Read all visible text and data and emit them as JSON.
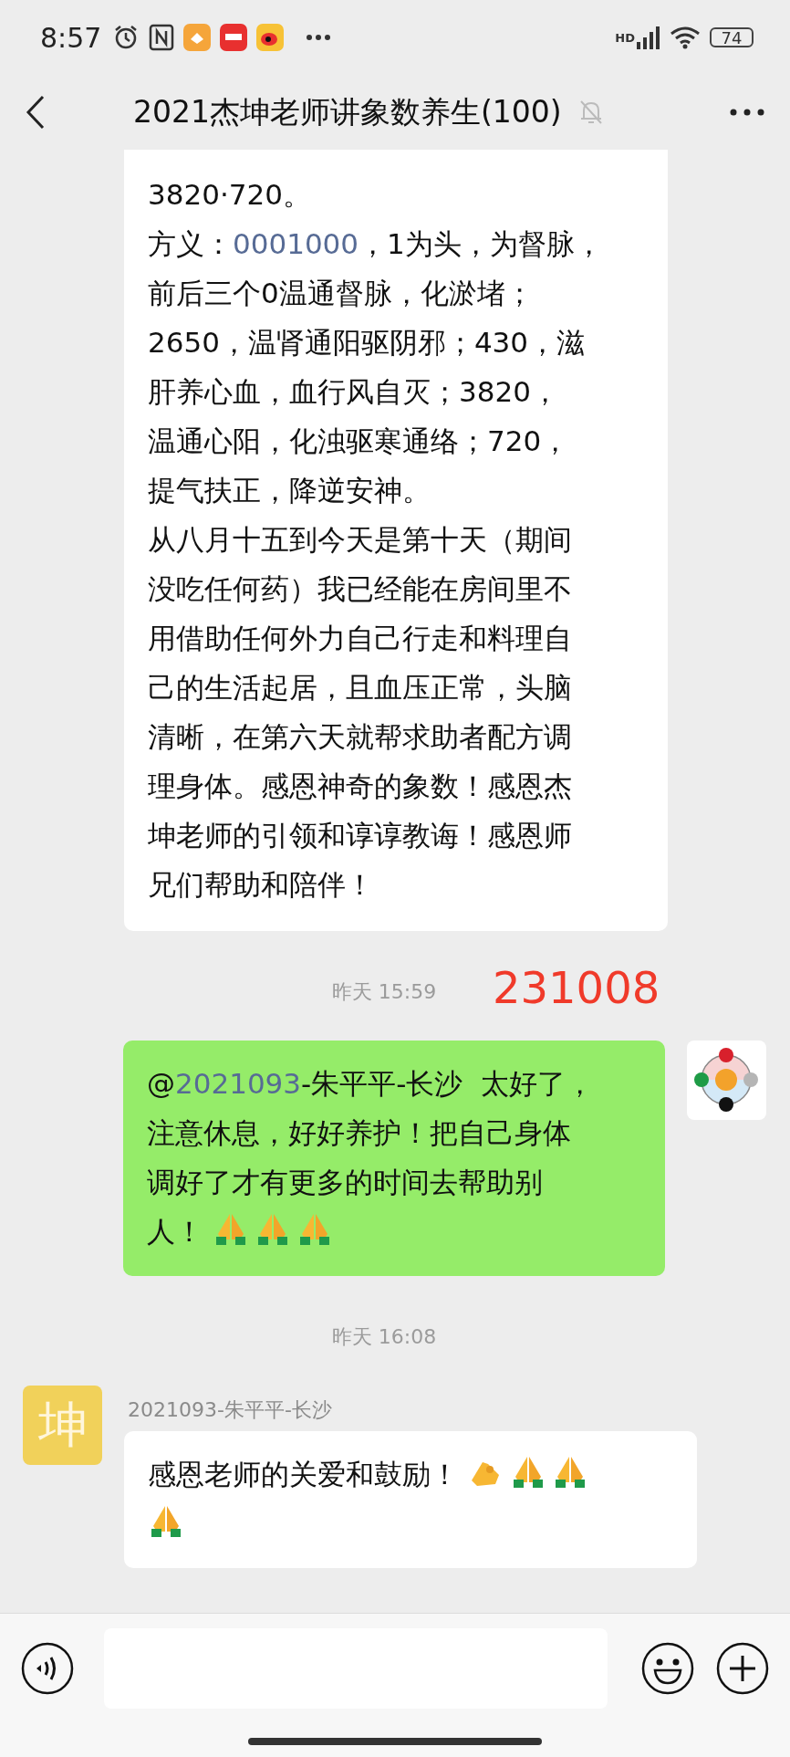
{
  "status_bar": {
    "time": "8:57",
    "network": "HD",
    "battery": "74"
  },
  "nav": {
    "title": "2021杰坤老师讲象数养生(100)",
    "muted": true
  },
  "messages": [
    {
      "kind": "incoming",
      "cut_top": true,
      "lines": [
        [
          {
            "kind": "text",
            "text": "3820·720。"
          }
        ],
        [
          {
            "kind": "text",
            "text": "方义："
          },
          {
            "kind": "link",
            "text": "0001000"
          },
          {
            "kind": "text",
            "text": "，1为头，为督脉，"
          }
        ],
        [
          {
            "kind": "text",
            "text": "前后三个0温通督脉，化淤堵；"
          }
        ],
        [
          {
            "kind": "text",
            "text": "2650，温肾通阳驱阴邪；430，滋"
          }
        ],
        [
          {
            "kind": "text",
            "text": "肝养心血，血行风自灭；3820，"
          }
        ],
        [
          {
            "kind": "text",
            "text": "温通心阳，化浊驱寒通络；720，"
          }
        ],
        [
          {
            "kind": "text",
            "text": "提气扶正，降逆安神。"
          }
        ],
        [
          {
            "kind": "text",
            "text": "从八月十五到今天是第十天（期间"
          }
        ],
        [
          {
            "kind": "text",
            "text": "没吃任何药）我已经能在房间里不"
          }
        ],
        [
          {
            "kind": "text",
            "text": "用借助任何外力自己行走和料理自"
          }
        ],
        [
          {
            "kind": "text",
            "text": "己的生活起居，且血压正常，头脑"
          }
        ],
        [
          {
            "kind": "text",
            "text": "清晰，在第六天就帮求助者配方调"
          }
        ],
        [
          {
            "kind": "text",
            "text": "理身体。感恩神奇的象数！感恩杰"
          }
        ],
        [
          {
            "kind": "text",
            "text": "坤老师的引领和谆谆教诲！感恩师"
          }
        ],
        [
          {
            "kind": "text",
            "text": "兄们帮助和陪伴！"
          }
        ]
      ]
    },
    {
      "kind": "time",
      "text": "昨天 15:59",
      "annotation": "231008"
    },
    {
      "kind": "outgoing",
      "avatar": {
        "kind": "diagram"
      },
      "lines": [
        [
          {
            "kind": "text",
            "text": "@"
          },
          {
            "kind": "link",
            "text": "2021093"
          },
          {
            "kind": "text",
            "text": "-朱平平-长沙  太好了，"
          }
        ],
        [
          {
            "kind": "text",
            "text": "注意休息，好好养护！把自己身体"
          }
        ],
        [
          {
            "kind": "text",
            "text": "调好了才有更多的时间去帮助别"
          }
        ],
        [
          {
            "kind": "text",
            "text": "人！ "
          },
          {
            "kind": "pray"
          },
          {
            "kind": "pray"
          },
          {
            "kind": "pray"
          }
        ]
      ]
    },
    {
      "kind": "time",
      "text": "昨天 16:08"
    },
    {
      "kind": "incoming",
      "sender": "2021093-朱平平-长沙",
      "avatar": {
        "kind": "glyph",
        "text": "坤"
      },
      "lines": [
        [
          {
            "kind": "text",
            "text": "感恩老师的关爱和鼓励！ "
          },
          {
            "kind": "ok"
          },
          {
            "kind": "pray"
          },
          {
            "kind": "pray"
          }
        ],
        [
          {
            "kind": "pray"
          }
        ]
      ]
    }
  ]
}
